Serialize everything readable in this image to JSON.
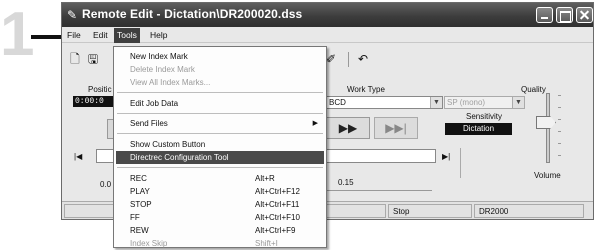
{
  "step_number": "1",
  "window": {
    "title": "Remote Edit - Dictation\\DR200020.dss"
  },
  "menubar": [
    "File",
    "Edit",
    "Tools",
    "Help"
  ],
  "main": {
    "position_label": "Positic",
    "position_value": "0:00:0",
    "work_type_label": "Work Type",
    "work_type_value": "BCD",
    "quality_label": "Quality",
    "quality_value": "SP (mono)",
    "sensitivity_label": "Sensitivity",
    "sensitivity_value": "Dictation",
    "volume_label": "Volume",
    "pos_left_value": "0.0",
    "tick_value": "0.15"
  },
  "statusbar": [
    "",
    "",
    "Stop",
    "DR2000"
  ],
  "tools_menu": {
    "group1": [
      {
        "label": "New Index Mark",
        "enabled": true
      },
      {
        "label": "Delete Index Mark",
        "enabled": false
      },
      {
        "label": "View All Index Marks...",
        "enabled": false
      }
    ],
    "edit_job_data": "Edit Job Data",
    "send_files": "Send Files",
    "show_custom_button": "Show Custom Button",
    "directrec_config": "Directrec Configuration Tool",
    "commands": [
      {
        "label": "REC",
        "shortcut": "Alt+R"
      },
      {
        "label": "PLAY",
        "shortcut": "Alt+Ctrl+F12"
      },
      {
        "label": "STOP",
        "shortcut": "Alt+Ctrl+F11"
      },
      {
        "label": "FF",
        "shortcut": "Alt+Ctrl+F10"
      },
      {
        "label": "REW",
        "shortcut": "Alt+Ctrl+F9"
      },
      {
        "label": "Index Skip",
        "shortcut": "Shift+I"
      }
    ]
  }
}
